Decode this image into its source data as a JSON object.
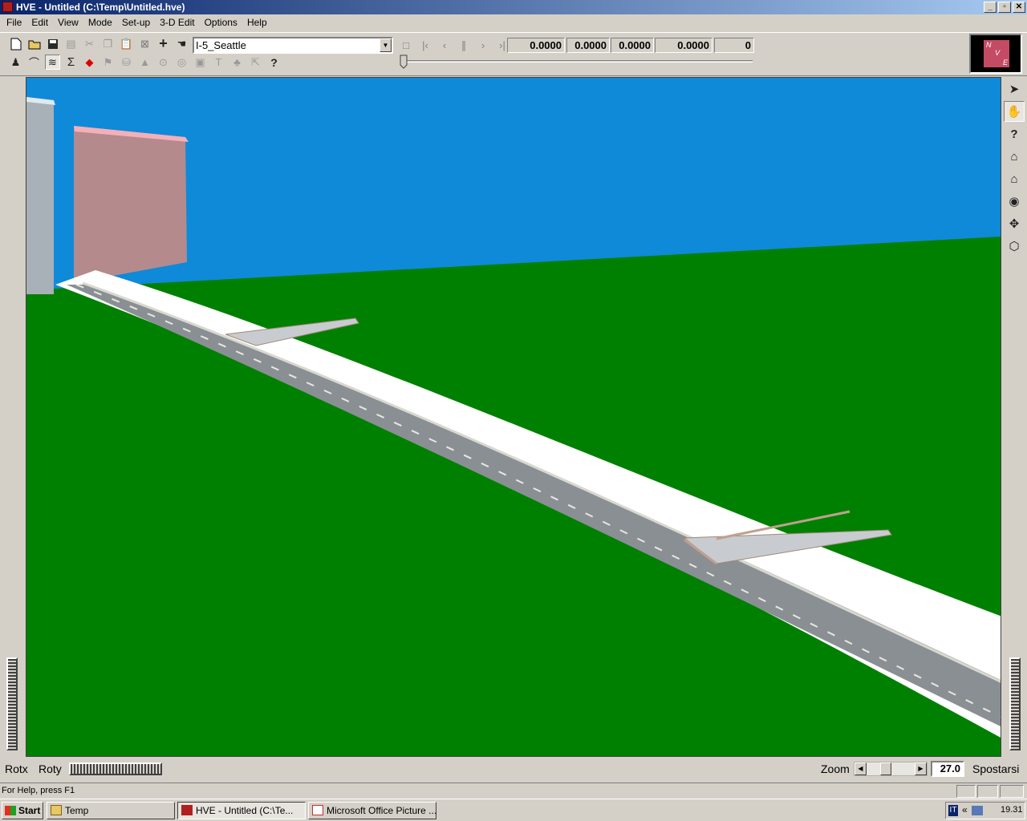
{
  "window": {
    "title": "HVE - Untitled (C:\\Temp\\Untitled.hve)",
    "minimize": "_",
    "restore": "▫",
    "close": "✕"
  },
  "menu": [
    "File",
    "Edit",
    "View",
    "Mode",
    "Set-up",
    "3-D Edit",
    "Options",
    "Help"
  ],
  "toolbar": {
    "environment_select": "I-5_Seattle",
    "readouts": [
      "0.0000",
      "0.0000",
      "0.0000",
      "0.0000",
      "0"
    ],
    "help_glyph": "?"
  },
  "compass": {
    "n": "N",
    "v": "V",
    "e": "E"
  },
  "right_tools": [
    "select-arrow",
    "hand",
    "help",
    "home",
    "home-edit",
    "eye",
    "move",
    "perspective"
  ],
  "right_tool_help": "?",
  "bottom": {
    "rotx_label": "Rotx",
    "roty_label": "Roty",
    "zoom_label": "Zoom",
    "zoom_value": "27.0",
    "pan_label": "Spostarsi"
  },
  "status": {
    "help_text": "For Help, press F1"
  },
  "taskbar": {
    "start_label": "Start",
    "tasks": [
      "Temp",
      "HVE - Untitled (C:\\Te...",
      "Microsoft Office Picture ..."
    ],
    "tray_lang": "IT",
    "tray_chevron": "«",
    "clock": "19.31"
  }
}
